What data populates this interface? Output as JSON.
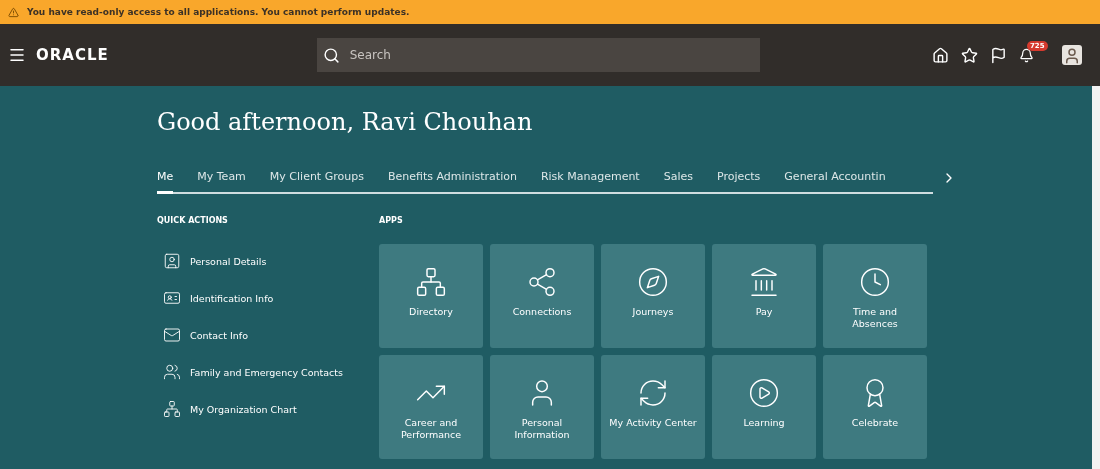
{
  "banner": {
    "text": "You have read-only access to all applications. You cannot perform updates."
  },
  "header": {
    "logo": "ORACLE",
    "search": {
      "placeholder": "Search"
    },
    "notifications": "725"
  },
  "greeting": "Good afternoon, Ravi Chouhan",
  "tabs": [
    {
      "label": "Me",
      "selected": true
    },
    {
      "label": "My Team",
      "selected": false
    },
    {
      "label": "My Client Groups",
      "selected": false
    },
    {
      "label": "Benefits Administration",
      "selected": false
    },
    {
      "label": "Risk Management",
      "selected": false
    },
    {
      "label": "Sales",
      "selected": false
    },
    {
      "label": "Projects",
      "selected": false
    },
    {
      "label": "General Accountin",
      "selected": false
    }
  ],
  "quick_actions": {
    "title": "QUICK ACTIONS",
    "items": [
      "Personal Details",
      "Identification Info",
      "Contact Info",
      "Family and Emergency Contacts",
      "My Organization Chart"
    ]
  },
  "apps": {
    "title": "APPS",
    "items": [
      "Directory",
      "Connections",
      "Journeys",
      "Pay",
      "Time and Absences",
      "Career and Performance",
      "Personal Information",
      "My Activity Center",
      "Learning",
      "Celebrate"
    ]
  }
}
